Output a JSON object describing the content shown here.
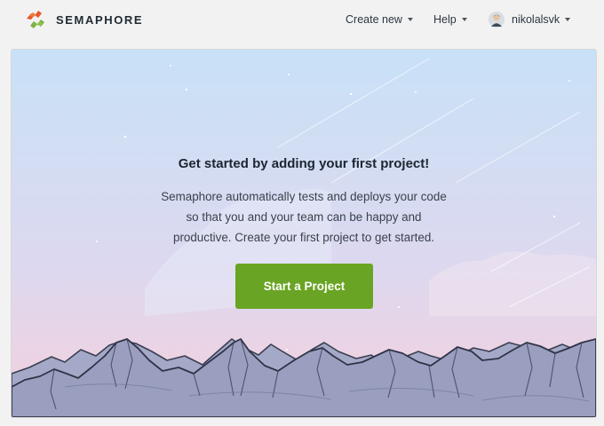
{
  "brand": {
    "name": "SEMAPHORE",
    "logo_colors": [
      "#e8562a",
      "#7cb342"
    ]
  },
  "nav": {
    "create_new": "Create new",
    "help": "Help",
    "username": "nikolalsvk"
  },
  "empty_state": {
    "title": "Get started by adding your first project!",
    "description_lines": [
      "Semaphore automatically tests and deploys your code",
      "so that you and your team can be happy and",
      "productive. Create your first project to get started."
    ],
    "cta_label": "Start a Project",
    "cta_color": "#6aa424"
  }
}
